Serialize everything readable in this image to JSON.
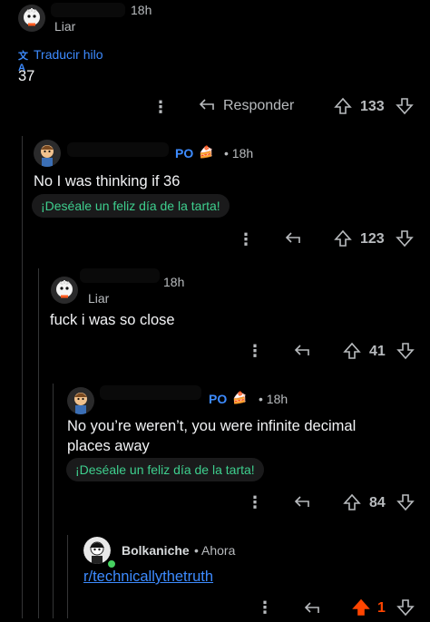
{
  "colors": {
    "background": "#000000",
    "text": "#f2f3f5",
    "muted": "#b8bbbe",
    "link": "#3d8bff",
    "op_badge": "#3d8bff",
    "cake_text": "#3ecf8e",
    "upvoted": "#ff4500"
  },
  "comments": [
    {
      "time": "18h",
      "flair": "Liar",
      "translate_label": "Traducir hilo",
      "body": "37",
      "reply_label": "Responder",
      "votes": "133"
    },
    {
      "op_badge": "PO",
      "cake_icon": "cake-icon",
      "time": "• 18h",
      "body": "No I was thinking if 36",
      "cake_day": "¡Deséale un feliz día de la tarta!",
      "votes": "123"
    },
    {
      "time": "18h",
      "flair": "Liar",
      "body": "fuck i was so close",
      "votes": "41"
    },
    {
      "op_badge": "PO",
      "cake_icon": "cake-icon",
      "time": "• 18h",
      "body_line1": "No you’re weren’t, you were infinite decimal",
      "body_line2": "places away",
      "cake_day": "¡Deséale un feliz día de la tarta!",
      "votes": "84"
    },
    {
      "username": "Bolkaniche",
      "time": "• Ahora",
      "link": "r/technicallythetruth",
      "votes": "1",
      "upvoted": true
    }
  ]
}
